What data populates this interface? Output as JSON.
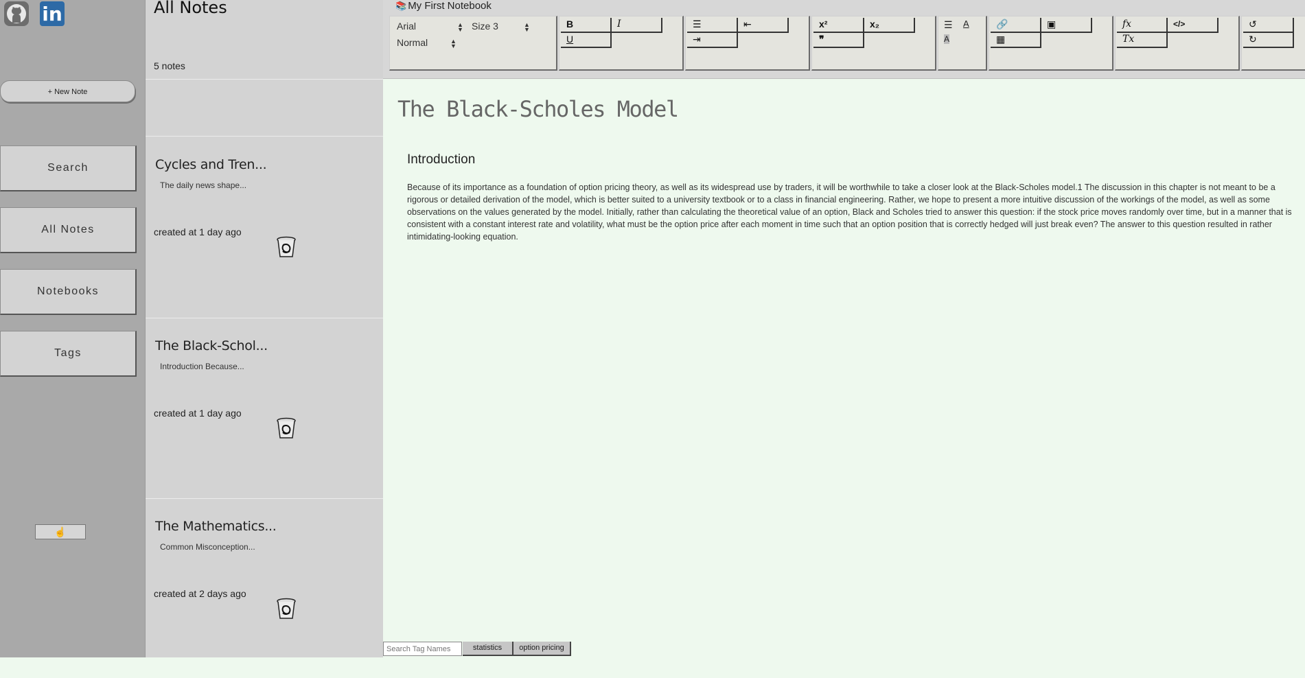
{
  "sidebar": {
    "github_label": "GitHub",
    "linkedin_label": "in",
    "new_note": "+ New Note",
    "nav": [
      "Search",
      "All Notes",
      "Notebooks",
      "Tags"
    ],
    "footer_icon": "hand-pointer-icon"
  },
  "notes_list": {
    "title": "All Notes",
    "count": "5 notes",
    "notes": [
      {
        "title": "Cycles and Tren...",
        "snippet": "The daily news shape...",
        "created": "created at 1 day ago"
      },
      {
        "title": "The Black-Schol...",
        "snippet": "Introduction Because...",
        "created": "created at 1 day ago"
      },
      {
        "title": "The Mathematics...",
        "snippet": "Common Misconception...",
        "created": "created at 2 days ago"
      }
    ]
  },
  "editor": {
    "notebook": "My First Notebook",
    "toolbar": {
      "font": "Arial",
      "size": "Size 3",
      "heading": "Normal",
      "bold": "B",
      "italic": "I",
      "underline": "U",
      "superscript": "x²",
      "subscript": "x₂",
      "quote": "❞",
      "formula": "𝑓x",
      "clear_format": "Tx",
      "code": "</>"
    },
    "doc_title": "The Black-Scholes Model",
    "heading": "Introduction",
    "body": "Because of its importance as a foundation of option pricing theory, as well as its widespread use by traders, it will be worthwhile to take a closer look at the Black-Scholes model.1 The discussion in this chapter is not meant to be a rigorous or detailed derivation of the model, which is better suited to a university textbook or to a class in financial engineering. Rather, we hope to present a more intuitive discussion of the workings of the model, as well as some observations on the values generated by the model. Initially, rather than calculating the theoretical value of an option, Black and Scholes tried to answer this question: if the stock price moves randomly over time, but in a manner that is consistent with a constant interest rate and volatility, what must be the option price after each moment in time such that an option position that is correctly hedged will just break even? The answer to this question resulted in rather intimidating-looking equation."
  },
  "tags": {
    "search_placeholder": "Search Tag Names",
    "items": [
      "statistics",
      "option pricing"
    ]
  },
  "colors": {
    "sidebar_bg": "#a9a9a9",
    "list_bg": "#d3d3d3",
    "editor_bg": "#eef9ee",
    "linkedin": "#2d6aa6"
  }
}
